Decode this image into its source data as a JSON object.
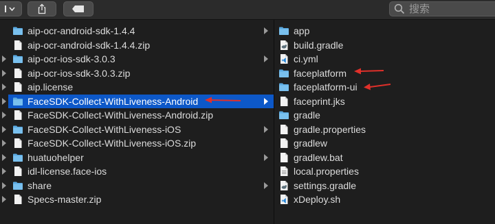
{
  "toolbar": {
    "search_placeholder": "搜索"
  },
  "left_column": {
    "items": [
      {
        "name": "aip-ocr-android-sdk-1.4.4",
        "icon": "folder-icon",
        "has_children": true,
        "selected": false,
        "edge_indicator": false
      },
      {
        "name": "aip-ocr-android-sdk-1.4.4.zip",
        "icon": "file-icon",
        "has_children": false,
        "selected": false,
        "edge_indicator": false
      },
      {
        "name": "aip-ocr-ios-sdk-3.0.3",
        "icon": "folder-icon",
        "has_children": true,
        "selected": false,
        "edge_indicator": true
      },
      {
        "name": "aip-ocr-ios-sdk-3.0.3.zip",
        "icon": "file-icon",
        "has_children": false,
        "selected": false,
        "edge_indicator": true
      },
      {
        "name": "aip.license",
        "icon": "file-icon",
        "has_children": false,
        "selected": false,
        "edge_indicator": true
      },
      {
        "name": "FaceSDK-Collect-WithLiveness-Android",
        "icon": "folder-icon",
        "has_children": true,
        "selected": true,
        "edge_indicator": true
      },
      {
        "name": "FaceSDK-Collect-WithLiveness-Android.zip",
        "icon": "file-icon",
        "has_children": false,
        "selected": false,
        "edge_indicator": true
      },
      {
        "name": "FaceSDK-Collect-WithLiveness-iOS",
        "icon": "folder-icon",
        "has_children": true,
        "selected": false,
        "edge_indicator": true
      },
      {
        "name": "FaceSDK-Collect-WithLiveness-iOS.zip",
        "icon": "file-icon",
        "has_children": false,
        "selected": false,
        "edge_indicator": true
      },
      {
        "name": "huatuohelper",
        "icon": "folder-icon",
        "has_children": true,
        "selected": false,
        "edge_indicator": true
      },
      {
        "name": "idl-license.face-ios",
        "icon": "file-icon",
        "has_children": false,
        "selected": false,
        "edge_indicator": true
      },
      {
        "name": "share",
        "icon": "folder-icon",
        "has_children": true,
        "selected": false,
        "edge_indicator": true
      },
      {
        "name": "Specs-master.zip",
        "icon": "file-icon",
        "has_children": false,
        "selected": false,
        "edge_indicator": true
      }
    ]
  },
  "right_column": {
    "items": [
      {
        "name": "app",
        "icon": "folder-icon",
        "annotated": false
      },
      {
        "name": "build.gradle",
        "icon": "gradle-file-icon",
        "annotated": false
      },
      {
        "name": "ci.yml",
        "icon": "vscode-file-icon",
        "annotated": false
      },
      {
        "name": "faceplatform",
        "icon": "folder-icon",
        "annotated": true
      },
      {
        "name": "faceplatform-ui",
        "icon": "folder-icon",
        "annotated": true
      },
      {
        "name": "faceprint.jks",
        "icon": "file-icon",
        "annotated": false
      },
      {
        "name": "gradle",
        "icon": "folder-icon",
        "annotated": false
      },
      {
        "name": "gradle.properties",
        "icon": "file-icon",
        "annotated": false
      },
      {
        "name": "gradlew",
        "icon": "file-icon",
        "annotated": false
      },
      {
        "name": "gradlew.bat",
        "icon": "file-icon",
        "annotated": false
      },
      {
        "name": "local.properties",
        "icon": "document-icon",
        "annotated": false
      },
      {
        "name": "settings.gradle",
        "icon": "gradle-file-icon",
        "annotated": false
      },
      {
        "name": "xDeploy.sh",
        "icon": "vscode-file-icon",
        "annotated": false
      }
    ]
  },
  "colors": {
    "selection": "#0d58c8",
    "folder": "#6fb6e6",
    "annotation_arrow": "#e0302a"
  }
}
